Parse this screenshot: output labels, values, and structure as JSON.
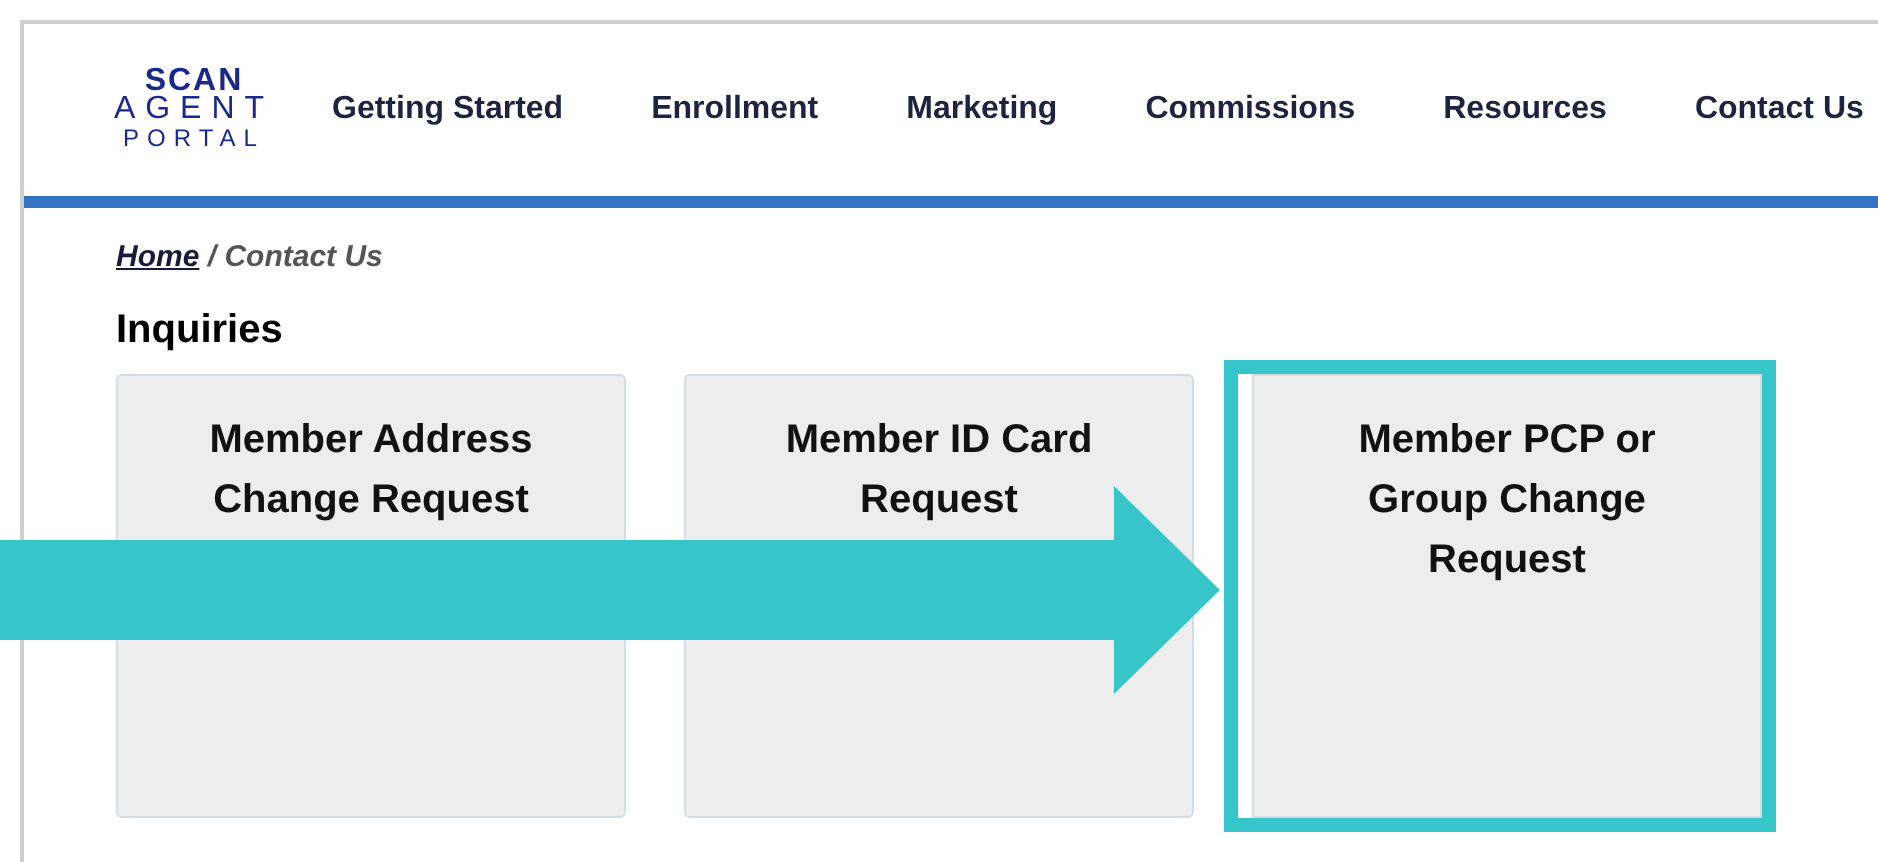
{
  "logo": {
    "lines": [
      "SCAN",
      "AGENT",
      "PORTAL"
    ]
  },
  "nav": [
    "Getting Started",
    "Enrollment",
    "Marketing",
    "Commissions",
    "Resources",
    "Contact Us"
  ],
  "breadcrumb": {
    "home": "Home",
    "current": "/ Contact Us"
  },
  "heading": "Inquiries",
  "cards": [
    {
      "title": "Member Address Change Request",
      "highlighted": false
    },
    {
      "title": "Member ID Card Request",
      "highlighted": false
    },
    {
      "title": "Member PCP or Group Change Request",
      "highlighted": true
    }
  ]
}
